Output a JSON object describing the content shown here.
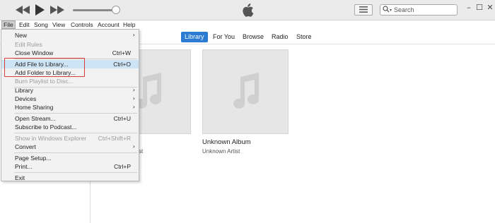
{
  "player": {
    "controls": [
      {
        "name": "rewind-icon"
      },
      {
        "name": "play-icon"
      },
      {
        "name": "fast-forward-icon"
      }
    ],
    "volume_level": 0.9
  },
  "search": {
    "placeholder": "Search"
  },
  "window_controls": {
    "minimize": "–",
    "maximize": "☐",
    "close": "✕"
  },
  "menubar": {
    "items": [
      "File",
      "Edit",
      "Song",
      "View",
      "Controls",
      "Account",
      "Help"
    ]
  },
  "tabs": {
    "items": [
      "Library",
      "For You",
      "Browse",
      "Radio",
      "Store"
    ],
    "selected": "Library"
  },
  "albums": [
    {
      "title": "",
      "artist": "st"
    },
    {
      "title": "Unknown Album",
      "artist": "Unknown Artist"
    }
  ],
  "file_menu": {
    "items": [
      {
        "label": "New",
        "shortcut": "",
        "submenu": true,
        "disabled": false
      },
      {
        "label": "Edit Rules",
        "shortcut": "",
        "submenu": false,
        "disabled": true
      },
      {
        "label": "Close Window",
        "shortcut": "Ctrl+W",
        "submenu": false,
        "disabled": false
      },
      {
        "label": "Add File to Library...",
        "shortcut": "Ctrl+O",
        "submenu": false,
        "disabled": false
      },
      {
        "label": "Add Folder to Library...",
        "shortcut": "",
        "submenu": false,
        "disabled": false
      },
      {
        "label": "Burn Playlist to Disc...",
        "shortcut": "",
        "submenu": false,
        "disabled": true
      },
      {
        "label": "Library",
        "shortcut": "",
        "submenu": true,
        "disabled": false
      },
      {
        "label": "Devices",
        "shortcut": "",
        "submenu": true,
        "disabled": false
      },
      {
        "label": "Home Sharing",
        "shortcut": "",
        "submenu": true,
        "disabled": false
      },
      {
        "label": "Open Stream...",
        "shortcut": "Ctrl+U",
        "submenu": false,
        "disabled": false
      },
      {
        "label": "Subscribe to Podcast...",
        "shortcut": "",
        "submenu": false,
        "disabled": false
      },
      {
        "label": "Show in Windows Explorer",
        "shortcut": "Ctrl+Shift+R",
        "submenu": false,
        "disabled": true
      },
      {
        "label": "Convert",
        "shortcut": "",
        "submenu": true,
        "disabled": false
      },
      {
        "label": "Page Setup...",
        "shortcut": "",
        "submenu": false,
        "disabled": false
      },
      {
        "label": "Print...",
        "shortcut": "Ctrl+P",
        "submenu": false,
        "disabled": false
      },
      {
        "label": "Exit",
        "shortcut": "",
        "submenu": false,
        "disabled": false
      }
    ],
    "highlighted_item": "Add File to Library..."
  },
  "colors": {
    "accent": "#2b7bd3",
    "highlight": "#cde4f7",
    "annotation_box": "#d93a3a"
  }
}
